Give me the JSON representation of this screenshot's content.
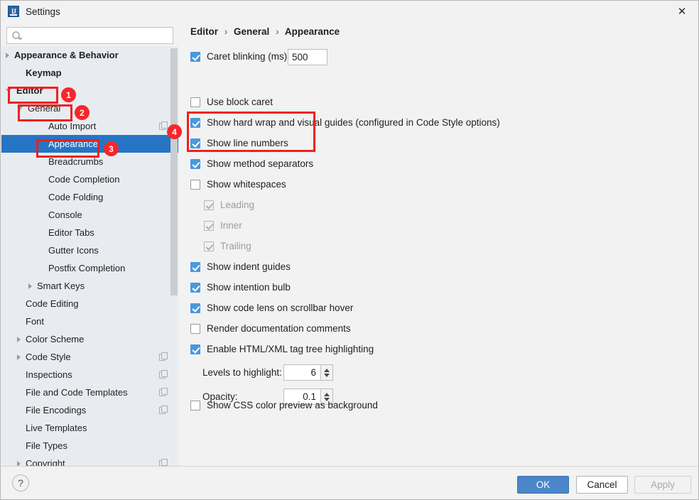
{
  "window": {
    "title": "Settings",
    "app_icon": "intellij-idea-icon",
    "close_label": "✕"
  },
  "search": {
    "value": "",
    "placeholder": "",
    "icon": "search-icon"
  },
  "sidebar": {
    "items": [
      {
        "label": "Appearance & Behavior",
        "indent": 0,
        "arrow": "right",
        "bold": true,
        "selected": false,
        "copy_icon": false
      },
      {
        "label": "Keymap",
        "indent": 1,
        "arrow": "none",
        "bold": true,
        "selected": false,
        "copy_icon": false
      },
      {
        "label": "Editor",
        "indent": 0,
        "arrow": "down",
        "bold": true,
        "selected": false,
        "copy_icon": false
      },
      {
        "label": "General",
        "indent": 1,
        "arrow": "down",
        "bold": false,
        "selected": false,
        "copy_icon": false
      },
      {
        "label": "Auto Import",
        "indent": 3,
        "arrow": "none",
        "bold": false,
        "selected": false,
        "copy_icon": true
      },
      {
        "label": "Appearance",
        "indent": 3,
        "arrow": "none",
        "bold": false,
        "selected": true,
        "copy_icon": false
      },
      {
        "label": "Breadcrumbs",
        "indent": 3,
        "arrow": "none",
        "bold": false,
        "selected": false,
        "copy_icon": false
      },
      {
        "label": "Code Completion",
        "indent": 3,
        "arrow": "none",
        "bold": false,
        "selected": false,
        "copy_icon": false
      },
      {
        "label": "Code Folding",
        "indent": 3,
        "arrow": "none",
        "bold": false,
        "selected": false,
        "copy_icon": false
      },
      {
        "label": "Console",
        "indent": 3,
        "arrow": "none",
        "bold": false,
        "selected": false,
        "copy_icon": false
      },
      {
        "label": "Editor Tabs",
        "indent": 3,
        "arrow": "none",
        "bold": false,
        "selected": false,
        "copy_icon": false
      },
      {
        "label": "Gutter Icons",
        "indent": 3,
        "arrow": "none",
        "bold": false,
        "selected": false,
        "copy_icon": false
      },
      {
        "label": "Postfix Completion",
        "indent": 3,
        "arrow": "none",
        "bold": false,
        "selected": false,
        "copy_icon": false
      },
      {
        "label": "Smart Keys",
        "indent": 2,
        "arrow": "right",
        "bold": false,
        "selected": false,
        "copy_icon": false
      },
      {
        "label": "Code Editing",
        "indent": 1,
        "arrow": "none",
        "bold": false,
        "selected": false,
        "copy_icon": false
      },
      {
        "label": "Font",
        "indent": 1,
        "arrow": "none",
        "bold": false,
        "selected": false,
        "copy_icon": false
      },
      {
        "label": "Color Scheme",
        "indent": 1,
        "arrow": "right",
        "bold": false,
        "selected": false,
        "copy_icon": false
      },
      {
        "label": "Code Style",
        "indent": 1,
        "arrow": "right",
        "bold": false,
        "selected": false,
        "copy_icon": true
      },
      {
        "label": "Inspections",
        "indent": 1,
        "arrow": "none",
        "bold": false,
        "selected": false,
        "copy_icon": true
      },
      {
        "label": "File and Code Templates",
        "indent": 1,
        "arrow": "none",
        "bold": false,
        "selected": false,
        "copy_icon": true
      },
      {
        "label": "File Encodings",
        "indent": 1,
        "arrow": "none",
        "bold": false,
        "selected": false,
        "copy_icon": true
      },
      {
        "label": "Live Templates",
        "indent": 1,
        "arrow": "none",
        "bold": false,
        "selected": false,
        "copy_icon": false
      },
      {
        "label": "File Types",
        "indent": 1,
        "arrow": "none",
        "bold": false,
        "selected": false,
        "copy_icon": false
      },
      {
        "label": "Copyright",
        "indent": 1,
        "arrow": "right",
        "bold": false,
        "selected": false,
        "copy_icon": true
      }
    ]
  },
  "main": {
    "breadcrumb": {
      "part1": "Editor",
      "part2": "General",
      "part3": "Appearance",
      "separator": "›"
    },
    "caret_blinking": {
      "label": "Caret blinking (ms):",
      "checked": true,
      "value": "500"
    },
    "options": [
      {
        "label": "Use block caret",
        "checked": false,
        "disabled": false
      },
      {
        "label": "Show hard wrap and visual guides (configured in Code Style options)",
        "checked": true,
        "disabled": false
      },
      {
        "label": "Show line numbers",
        "checked": true,
        "disabled": false
      },
      {
        "label": "Show method separators",
        "checked": true,
        "disabled": false
      },
      {
        "label": "Show whitespaces",
        "checked": false,
        "disabled": false
      },
      {
        "label": "Leading",
        "checked": true,
        "disabled": true
      },
      {
        "label": "Inner",
        "checked": true,
        "disabled": true
      },
      {
        "label": "Trailing",
        "checked": true,
        "disabled": true
      },
      {
        "label": "Show indent guides",
        "checked": true,
        "disabled": false
      },
      {
        "label": "Show intention bulb",
        "checked": true,
        "disabled": false
      },
      {
        "label": "Show code lens on scrollbar hover",
        "checked": true,
        "disabled": false
      },
      {
        "label": "Render documentation comments",
        "checked": false,
        "disabled": false
      },
      {
        "label": "Enable HTML/XML tag tree highlighting",
        "checked": true,
        "disabled": false
      }
    ],
    "levels_to_highlight": {
      "label": "Levels to highlight:",
      "value": "6"
    },
    "opacity": {
      "label": "Opacity:",
      "value": "0.1"
    },
    "css_preview": {
      "label": "Show CSS color preview as background",
      "checked": false
    }
  },
  "footer": {
    "help_label": "?",
    "ok_label": "OK",
    "cancel_label": "Cancel",
    "apply_label": "Apply"
  },
  "annotations": {
    "badge1": "1",
    "badge2": "2",
    "badge3": "3",
    "badge4": "4"
  },
  "colors": {
    "selection_blue": "#2675c4",
    "checkbox_blue": "#4a98dd",
    "annotation_red": "#f7262b",
    "sidebar_bg": "#e8ecf0",
    "panel_bg": "#f2f2f2"
  }
}
